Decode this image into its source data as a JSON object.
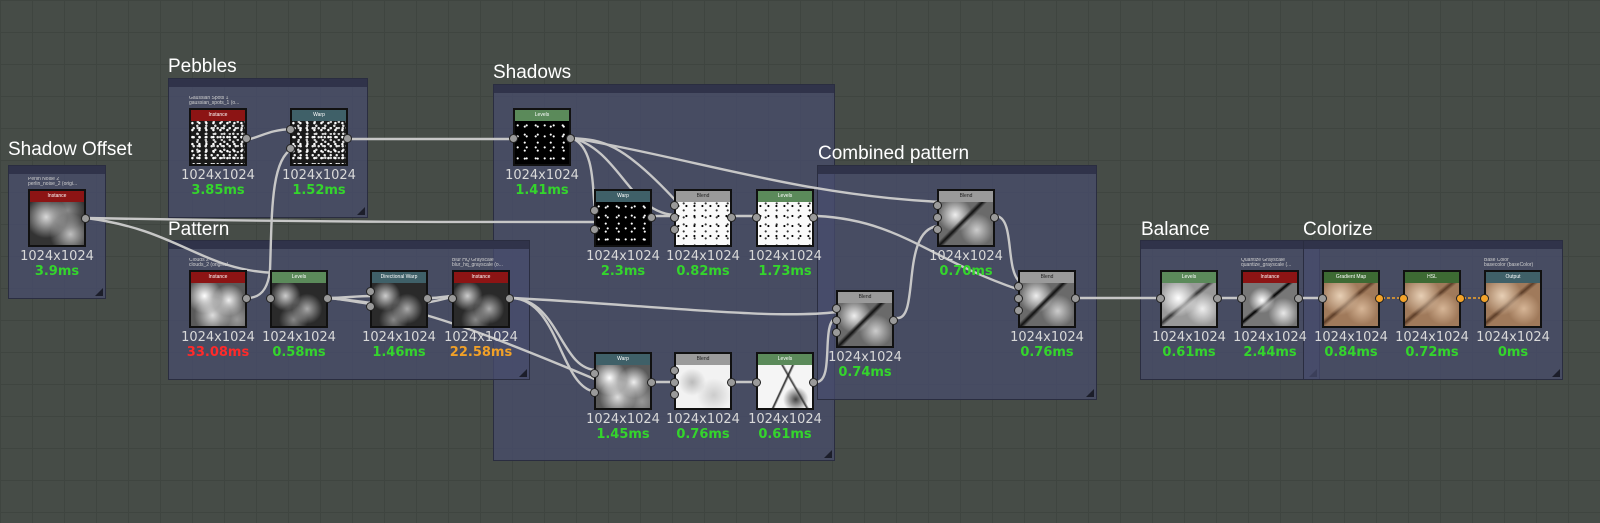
{
  "frames": {
    "shadow_offset": "Shadow Offset",
    "pebbles": "Pebbles",
    "shadows": "Shadows",
    "combined": "Combined pattern",
    "pattern": "Pattern",
    "balance": "Balance",
    "colorize": "Colorize"
  },
  "nodes": {
    "perlin": {
      "caption": "Perlin Noise 2",
      "sub": "perlin_noise_2 (origi...",
      "header": "Instance",
      "res": "1024x1024",
      "time": "3.9ms"
    },
    "gauss": {
      "caption": "Gaussian Spots 1",
      "sub": "gaussian_spots_1 (o...",
      "header": "Instance",
      "res": "1024x1024",
      "time": "3.85ms"
    },
    "warp1": {
      "header": "Warp",
      "res": "1024x1024",
      "time": "1.52ms"
    },
    "levels1": {
      "header": "Levels",
      "res": "1024x1024",
      "time": "1.41ms"
    },
    "warp2": {
      "header": "Warp",
      "res": "1024x1024",
      "time": "2.3ms"
    },
    "blend1": {
      "header": "Blend",
      "res": "1024x1024",
      "time": "0.82ms"
    },
    "levels2": {
      "header": "Levels",
      "res": "1024x1024",
      "time": "1.73ms"
    },
    "blend_top": {
      "header": "Blend",
      "res": "1024x1024",
      "time": "0.70ms"
    },
    "clouds": {
      "caption": "Clouds 2",
      "sub": "clouds_2 (original ...",
      "header": "Instance",
      "res": "1024x1024",
      "time": "33.08ms",
      "time_color": "#ff2a2a"
    },
    "levels3": {
      "header": "Levels",
      "res": "1024x1024",
      "time": "0.58ms"
    },
    "dirwarp": {
      "header": "Directional Warp",
      "res": "1024x1024",
      "time": "1.46ms"
    },
    "blurhq": {
      "caption": "Blur HQ Grayscale",
      "sub": "blur_hq_grayscale (o...",
      "header": "Instance",
      "res": "1024x1024",
      "time": "22.58ms",
      "time_color": "#f0a028"
    },
    "warp3": {
      "header": "Warp",
      "res": "1024x1024",
      "time": "1.45ms"
    },
    "blend2": {
      "header": "Blend",
      "res": "1024x1024",
      "time": "0.76ms"
    },
    "levels4": {
      "header": "Levels",
      "res": "1024x1024",
      "time": "0.61ms"
    },
    "blend_mid": {
      "header": "Blend",
      "res": "1024x1024",
      "time": "0.74ms"
    },
    "blend_final": {
      "header": "Blend",
      "res": "1024x1024",
      "time": "0.76ms"
    },
    "levels5": {
      "header": "Levels",
      "res": "1024x1024",
      "time": "0.61ms"
    },
    "quant": {
      "caption": "Quantize Grayscale",
      "sub": "quantize_grayscale (...",
      "header": "Instance",
      "res": "1024x1024",
      "time": "2.44ms"
    },
    "gradmap": {
      "header": "Gradient Map",
      "res": "1024x1024",
      "time": "0.84ms"
    },
    "hsl": {
      "header": "HSL",
      "res": "1024x1024",
      "time": "0.72ms"
    },
    "output": {
      "caption": "Base Color",
      "sub": "basecolor (baseColor)",
      "header": "Output",
      "res": "1024x1024",
      "time": "0ms"
    }
  },
  "colors": {
    "instance": "#8c1414",
    "warp": "#3f6068",
    "levels": "#5b8a5a",
    "blend": "#9a9a9a",
    "gradient": "#3d6a33",
    "output": "#3f6068",
    "ok": "#34d52c"
  }
}
